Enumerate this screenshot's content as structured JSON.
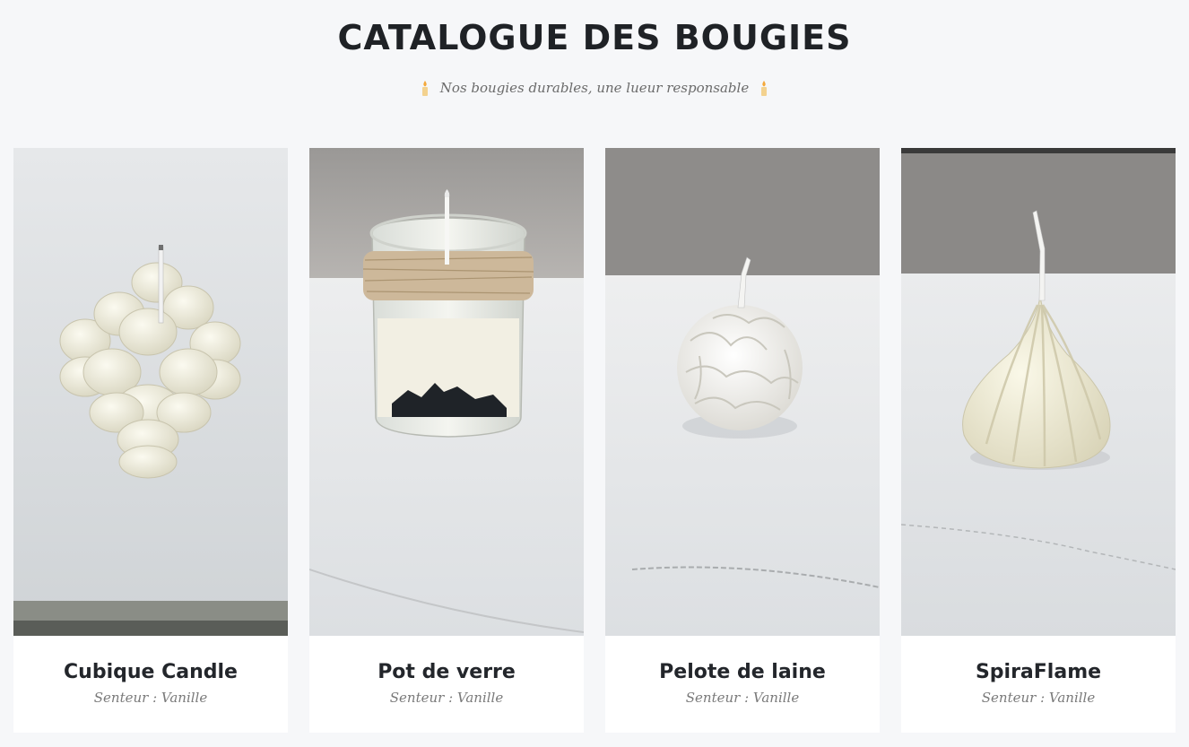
{
  "header": {
    "title": "CATALOGUE DES BOUGIES",
    "subtitle": "Nos bougies durables, une lueur responsable",
    "decoration_icon": "candle-icon"
  },
  "products": [
    {
      "name": "Cubique Candle",
      "scent": "Senteur : Vanille",
      "image": "bubble-cube-candle-photo"
    },
    {
      "name": "Pot de verre",
      "scent": "Senteur : Vanille",
      "image": "glass-jar-candle-photo"
    },
    {
      "name": "Pelote de laine",
      "scent": "Senteur : Vanille",
      "image": "yarn-ball-candle-photo"
    },
    {
      "name": "SpiraFlame",
      "scent": "Senteur : Vanille",
      "image": "spiral-candle-photo"
    }
  ],
  "colors": {
    "page_background": "#f6f7f9",
    "card_background": "#ffffff",
    "title": "#1f2226",
    "scent_text": "#7a7a7a",
    "wax": "#f1efe2"
  }
}
